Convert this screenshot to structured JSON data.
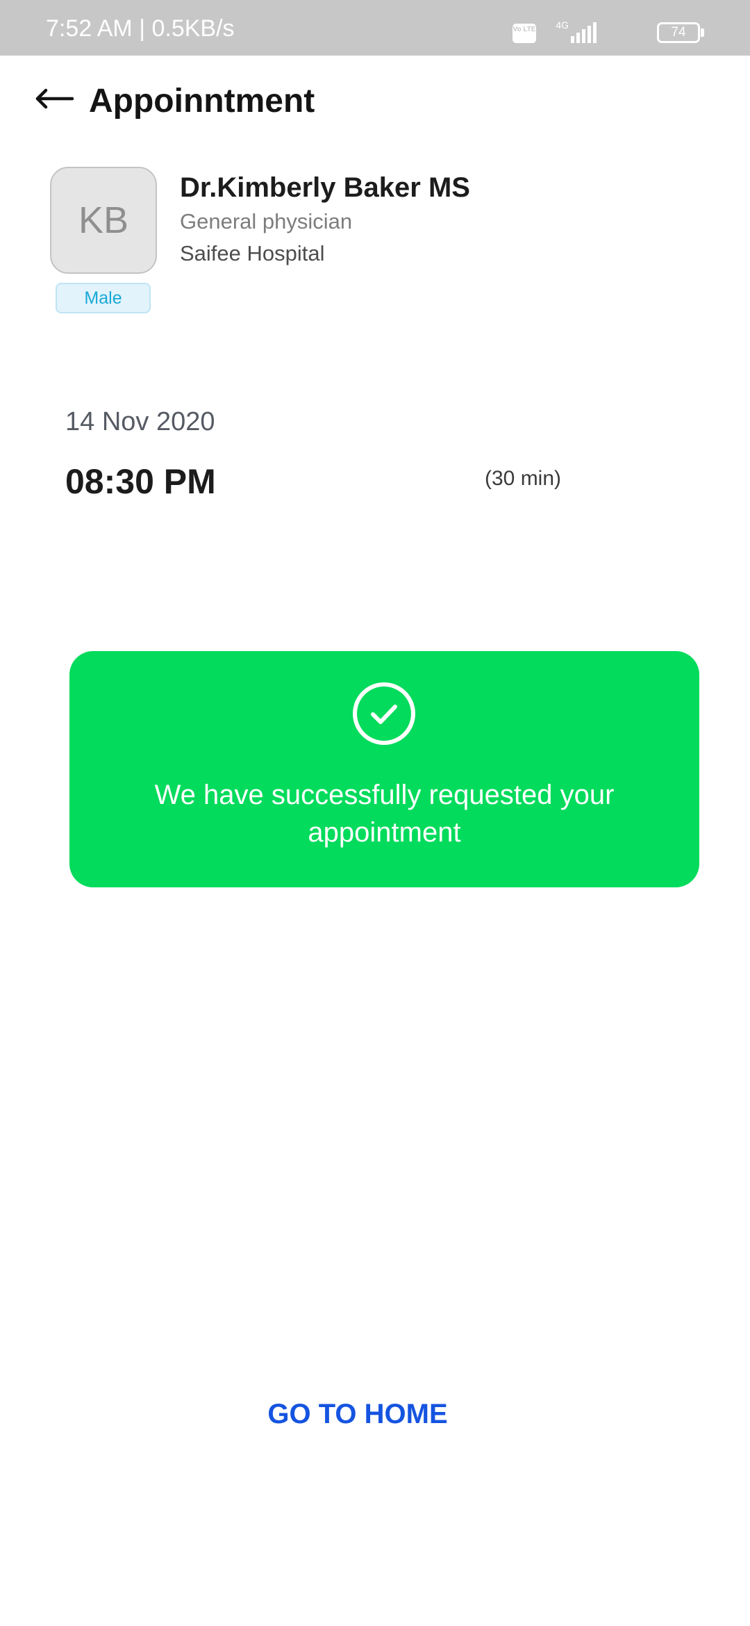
{
  "status_bar": {
    "time_speed": "7:52 AM | 0.5KB/s",
    "volte_label": "Vo LTE",
    "network": "4G",
    "battery": "74"
  },
  "header": {
    "title": "Appoinntment"
  },
  "doctor": {
    "initials": "KB",
    "gender": "Male",
    "name": "Dr.Kimberly Baker MS",
    "specialty": "General physician",
    "hospital": "Saifee Hospital"
  },
  "appointment": {
    "date": "14 Nov 2020",
    "time": "08:30 PM",
    "duration": "(30 min)"
  },
  "confirmation": {
    "message": "We have successfully requested your appointment"
  },
  "actions": {
    "home_label": "GO TO HOME"
  },
  "colors": {
    "status_bar": "#c7c7c7",
    "success": "#02db5b",
    "link": "#1554e0",
    "badge_text": "#18a9d8"
  }
}
